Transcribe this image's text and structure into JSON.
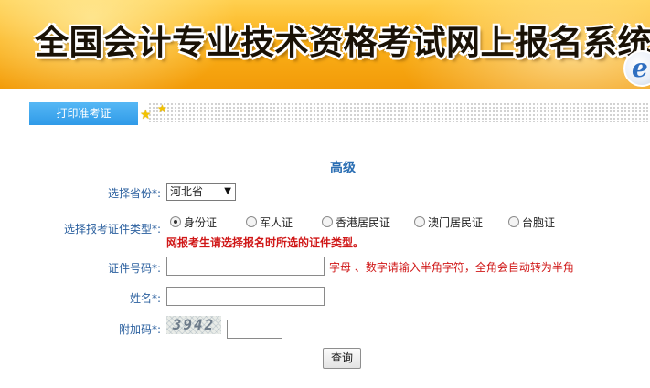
{
  "banner": {
    "title": "全国会计专业技术资格考试网上报名系统",
    "logo_glyph": "e"
  },
  "tab": {
    "label": "打印准考证"
  },
  "level": "高级",
  "form": {
    "province": {
      "label": "选择省份",
      "required_mark": "*:",
      "value": "河北省",
      "arrow": "▼"
    },
    "id_type": {
      "label": "选择报考证件类型",
      "required_mark": "*:",
      "options": [
        "身份证",
        "军人证",
        "香港居民证",
        "澳门居民证",
        "台胞证"
      ],
      "selected_index": 0,
      "warning": "网报考生请选择报名时所选的证件类型。"
    },
    "id_number": {
      "label": "证件号码",
      "required_mark": "*:",
      "value": "",
      "hint": "字母 、数字请输入半角字符，全角会自动转为半角"
    },
    "name": {
      "label": "姓名",
      "required_mark": "*:",
      "value": ""
    },
    "captcha": {
      "label": "附加码",
      "required_mark": "*:",
      "image_text": "3942",
      "value": ""
    },
    "submit_label": "查询"
  },
  "colors": {
    "tab_bg": "#2f9ae8",
    "label": "#2a5f9e",
    "warning": "#d01818",
    "level": "#2a6eb3"
  }
}
